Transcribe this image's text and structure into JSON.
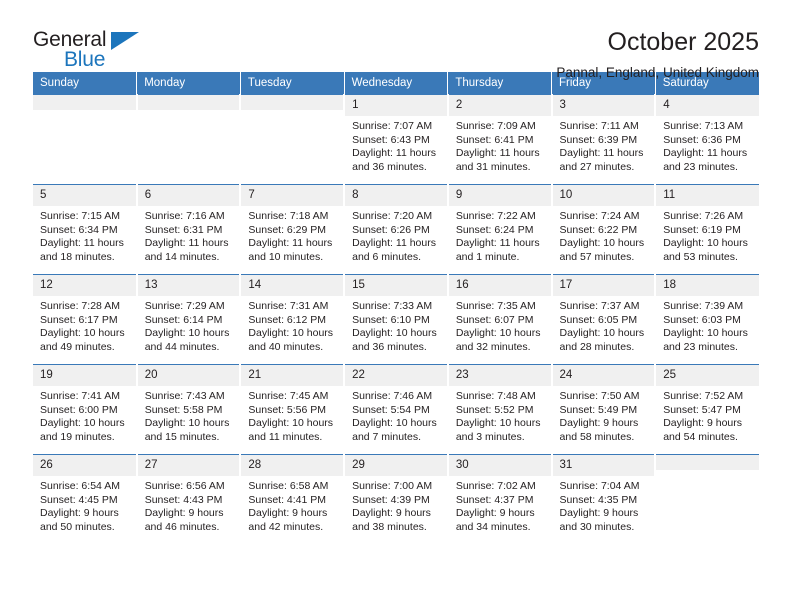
{
  "brand": {
    "name_part1": "General",
    "name_part2": "Blue",
    "triangle_color": "#1c75bc"
  },
  "header": {
    "title": "October 2025",
    "subtitle": "Pannal, England, United Kingdom"
  },
  "theme": {
    "header_row_bg": "#3a79b8",
    "daynum_bg": "#f0f0f0",
    "text": "#231f20"
  },
  "weekday_headers": [
    "Sunday",
    "Monday",
    "Tuesday",
    "Wednesday",
    "Thursday",
    "Friday",
    "Saturday"
  ],
  "labels": {
    "sunrise_prefix": "Sunrise:",
    "sunset_prefix": "Sunset:",
    "daylight_prefix": "Daylight:"
  },
  "weeks": [
    [
      {
        "day": "",
        "empty": true
      },
      {
        "day": "",
        "empty": true
      },
      {
        "day": "",
        "empty": true
      },
      {
        "day": "1",
        "sunrise": "Sunrise: 7:07 AM",
        "sunset": "Sunset: 6:43 PM",
        "daylight": "Daylight: 11 hours and 36 minutes."
      },
      {
        "day": "2",
        "sunrise": "Sunrise: 7:09 AM",
        "sunset": "Sunset: 6:41 PM",
        "daylight": "Daylight: 11 hours and 31 minutes."
      },
      {
        "day": "3",
        "sunrise": "Sunrise: 7:11 AM",
        "sunset": "Sunset: 6:39 PM",
        "daylight": "Daylight: 11 hours and 27 minutes."
      },
      {
        "day": "4",
        "sunrise": "Sunrise: 7:13 AM",
        "sunset": "Sunset: 6:36 PM",
        "daylight": "Daylight: 11 hours and 23 minutes."
      }
    ],
    [
      {
        "day": "5",
        "sunrise": "Sunrise: 7:15 AM",
        "sunset": "Sunset: 6:34 PM",
        "daylight": "Daylight: 11 hours and 18 minutes."
      },
      {
        "day": "6",
        "sunrise": "Sunrise: 7:16 AM",
        "sunset": "Sunset: 6:31 PM",
        "daylight": "Daylight: 11 hours and 14 minutes."
      },
      {
        "day": "7",
        "sunrise": "Sunrise: 7:18 AM",
        "sunset": "Sunset: 6:29 PM",
        "daylight": "Daylight: 11 hours and 10 minutes."
      },
      {
        "day": "8",
        "sunrise": "Sunrise: 7:20 AM",
        "sunset": "Sunset: 6:26 PM",
        "daylight": "Daylight: 11 hours and 6 minutes."
      },
      {
        "day": "9",
        "sunrise": "Sunrise: 7:22 AM",
        "sunset": "Sunset: 6:24 PM",
        "daylight": "Daylight: 11 hours and 1 minute."
      },
      {
        "day": "10",
        "sunrise": "Sunrise: 7:24 AM",
        "sunset": "Sunset: 6:22 PM",
        "daylight": "Daylight: 10 hours and 57 minutes."
      },
      {
        "day": "11",
        "sunrise": "Sunrise: 7:26 AM",
        "sunset": "Sunset: 6:19 PM",
        "daylight": "Daylight: 10 hours and 53 minutes."
      }
    ],
    [
      {
        "day": "12",
        "sunrise": "Sunrise: 7:28 AM",
        "sunset": "Sunset: 6:17 PM",
        "daylight": "Daylight: 10 hours and 49 minutes."
      },
      {
        "day": "13",
        "sunrise": "Sunrise: 7:29 AM",
        "sunset": "Sunset: 6:14 PM",
        "daylight": "Daylight: 10 hours and 44 minutes."
      },
      {
        "day": "14",
        "sunrise": "Sunrise: 7:31 AM",
        "sunset": "Sunset: 6:12 PM",
        "daylight": "Daylight: 10 hours and 40 minutes."
      },
      {
        "day": "15",
        "sunrise": "Sunrise: 7:33 AM",
        "sunset": "Sunset: 6:10 PM",
        "daylight": "Daylight: 10 hours and 36 minutes."
      },
      {
        "day": "16",
        "sunrise": "Sunrise: 7:35 AM",
        "sunset": "Sunset: 6:07 PM",
        "daylight": "Daylight: 10 hours and 32 minutes."
      },
      {
        "day": "17",
        "sunrise": "Sunrise: 7:37 AM",
        "sunset": "Sunset: 6:05 PM",
        "daylight": "Daylight: 10 hours and 28 minutes."
      },
      {
        "day": "18",
        "sunrise": "Sunrise: 7:39 AM",
        "sunset": "Sunset: 6:03 PM",
        "daylight": "Daylight: 10 hours and 23 minutes."
      }
    ],
    [
      {
        "day": "19",
        "sunrise": "Sunrise: 7:41 AM",
        "sunset": "Sunset: 6:00 PM",
        "daylight": "Daylight: 10 hours and 19 minutes."
      },
      {
        "day": "20",
        "sunrise": "Sunrise: 7:43 AM",
        "sunset": "Sunset: 5:58 PM",
        "daylight": "Daylight: 10 hours and 15 minutes."
      },
      {
        "day": "21",
        "sunrise": "Sunrise: 7:45 AM",
        "sunset": "Sunset: 5:56 PM",
        "daylight": "Daylight: 10 hours and 11 minutes."
      },
      {
        "day": "22",
        "sunrise": "Sunrise: 7:46 AM",
        "sunset": "Sunset: 5:54 PM",
        "daylight": "Daylight: 10 hours and 7 minutes."
      },
      {
        "day": "23",
        "sunrise": "Sunrise: 7:48 AM",
        "sunset": "Sunset: 5:52 PM",
        "daylight": "Daylight: 10 hours and 3 minutes."
      },
      {
        "day": "24",
        "sunrise": "Sunrise: 7:50 AM",
        "sunset": "Sunset: 5:49 PM",
        "daylight": "Daylight: 9 hours and 58 minutes."
      },
      {
        "day": "25",
        "sunrise": "Sunrise: 7:52 AM",
        "sunset": "Sunset: 5:47 PM",
        "daylight": "Daylight: 9 hours and 54 minutes."
      }
    ],
    [
      {
        "day": "26",
        "sunrise": "Sunrise: 6:54 AM",
        "sunset": "Sunset: 4:45 PM",
        "daylight": "Daylight: 9 hours and 50 minutes."
      },
      {
        "day": "27",
        "sunrise": "Sunrise: 6:56 AM",
        "sunset": "Sunset: 4:43 PM",
        "daylight": "Daylight: 9 hours and 46 minutes."
      },
      {
        "day": "28",
        "sunrise": "Sunrise: 6:58 AM",
        "sunset": "Sunset: 4:41 PM",
        "daylight": "Daylight: 9 hours and 42 minutes."
      },
      {
        "day": "29",
        "sunrise": "Sunrise: 7:00 AM",
        "sunset": "Sunset: 4:39 PM",
        "daylight": "Daylight: 9 hours and 38 minutes."
      },
      {
        "day": "30",
        "sunrise": "Sunrise: 7:02 AM",
        "sunset": "Sunset: 4:37 PM",
        "daylight": "Daylight: 9 hours and 34 minutes."
      },
      {
        "day": "31",
        "sunrise": "Sunrise: 7:04 AM",
        "sunset": "Sunset: 4:35 PM",
        "daylight": "Daylight: 9 hours and 30 minutes."
      },
      {
        "day": "",
        "empty": true
      }
    ]
  ]
}
